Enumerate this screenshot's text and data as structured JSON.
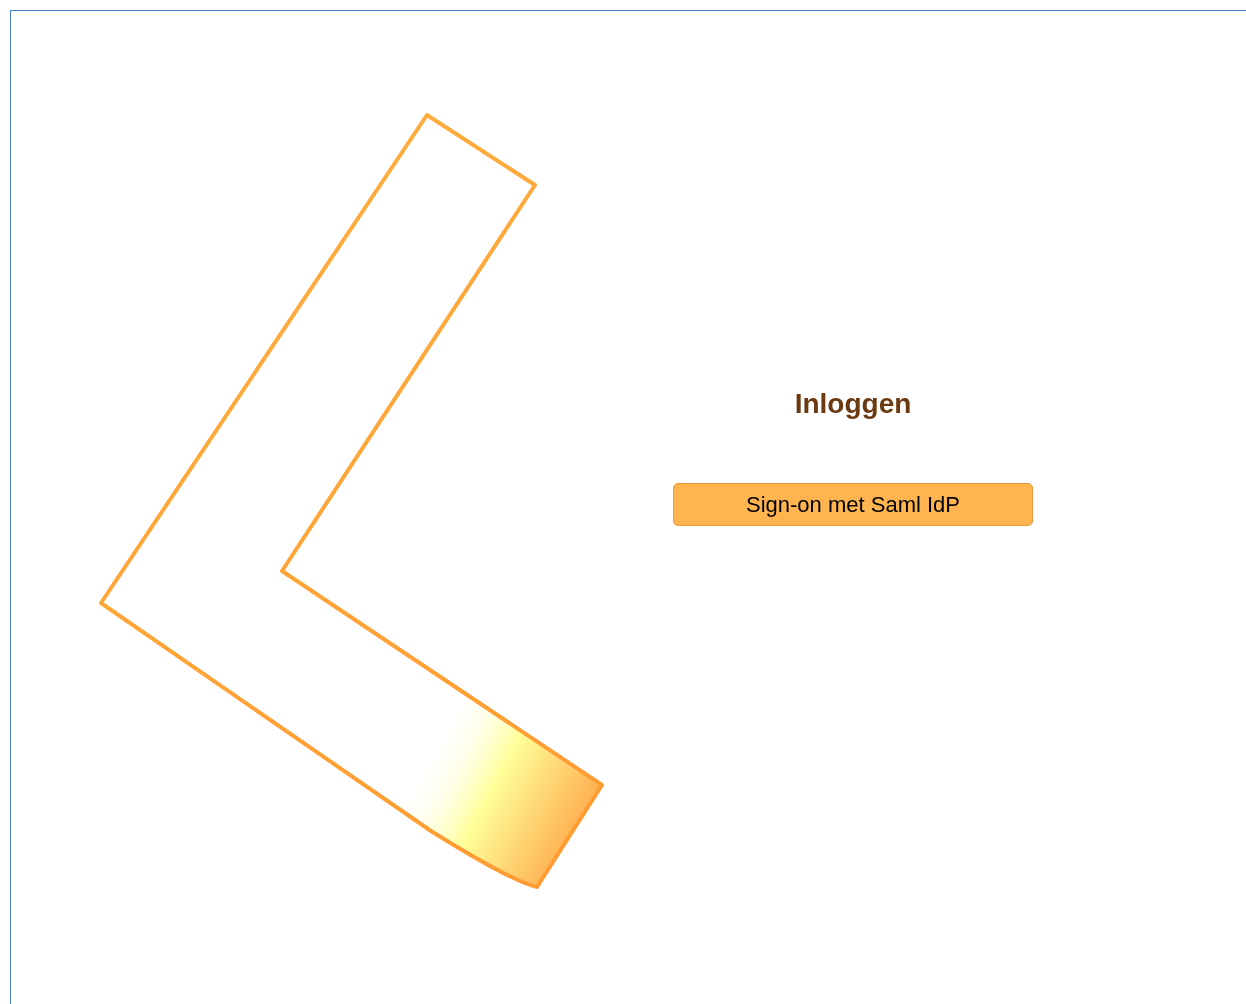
{
  "heading": "Inloggen",
  "buttons": [
    {
      "label": "Sign-on met Saml IdP"
    }
  ]
}
